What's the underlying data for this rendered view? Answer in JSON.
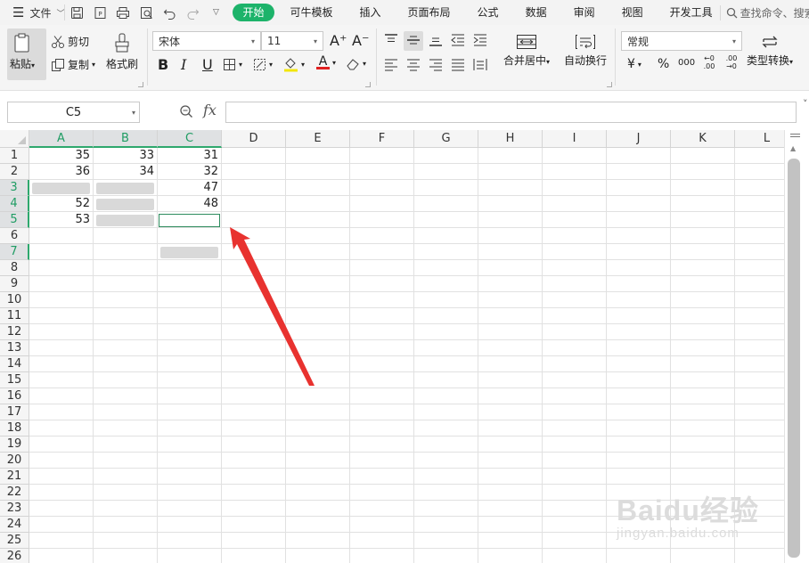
{
  "menu": {
    "file_label": "文件",
    "quick_access": [
      "save-icon",
      "export-pdf-icon",
      "print-icon",
      "print-preview-icon",
      "undo-icon",
      "redo-icon",
      "more-icon"
    ],
    "tabs": [
      {
        "label": "开始",
        "active": true
      },
      {
        "label": "可牛模板",
        "active": false
      },
      {
        "label": "插入",
        "active": false
      },
      {
        "label": "页面布局",
        "active": false
      },
      {
        "label": "公式",
        "active": false
      },
      {
        "label": "数据",
        "active": false
      },
      {
        "label": "审阅",
        "active": false
      },
      {
        "label": "视图",
        "active": false
      },
      {
        "label": "开发工具",
        "active": false
      }
    ],
    "search_placeholder": "查找命令、搜索模板",
    "active_tab_color": "#1db36a"
  },
  "ribbon": {
    "paste_label": "粘贴",
    "cut_label": "剪切",
    "copy_label": "复制",
    "format_painter_label": "格式刷",
    "font_name": "宋体",
    "font_size": "11",
    "bold_label": "B",
    "italic_label": "I",
    "underline_label": "U",
    "font_color_label": "A",
    "grow_font_label": "A⁺",
    "shrink_font_label": "A⁻",
    "merge_center_label": "合并居中",
    "wrap_text_label": "自动换行",
    "number_format": "常规",
    "currency_label": "¥",
    "percent_label": "%",
    "thousands_label": "000",
    "inc_decimal_label": "←0 .00",
    "dec_decimal_label": ".00 →0",
    "type_convert_label": "类型转换"
  },
  "formula_bar": {
    "name_box": "C5",
    "fx_label": "fx",
    "formula": ""
  },
  "sheet": {
    "columns": [
      "A",
      "B",
      "C",
      "D",
      "E",
      "F",
      "G",
      "H",
      "I",
      "J",
      "K",
      "L"
    ],
    "selected_columns": [
      "A",
      "B",
      "C"
    ],
    "rows": [
      "1",
      "2",
      "3",
      "4",
      "5",
      "6",
      "7",
      "8",
      "9",
      "10",
      "11",
      "12",
      "13",
      "14",
      "15",
      "16",
      "17",
      "18",
      "19",
      "20",
      "21",
      "22",
      "23",
      "24",
      "25",
      "26"
    ],
    "selected_rows": [
      "3",
      "4",
      "5",
      "7"
    ],
    "cells": {
      "A1": "35",
      "B1": "33",
      "C1": "31",
      "A2": "36",
      "B2": "34",
      "C2": "32",
      "C3": "47",
      "A4": "52",
      "C4": "48",
      "A5": "53"
    },
    "blank_selected_cells": [
      "A3",
      "B3",
      "B4",
      "B5",
      "C5",
      "C7"
    ],
    "active_cell": "C5",
    "accent_color": "#2ea86d"
  },
  "annotation": {
    "arrow_color": "#e8322f",
    "watermark": "Baidu经验",
    "watermark_sub": "jingyan.baidu.com"
  }
}
